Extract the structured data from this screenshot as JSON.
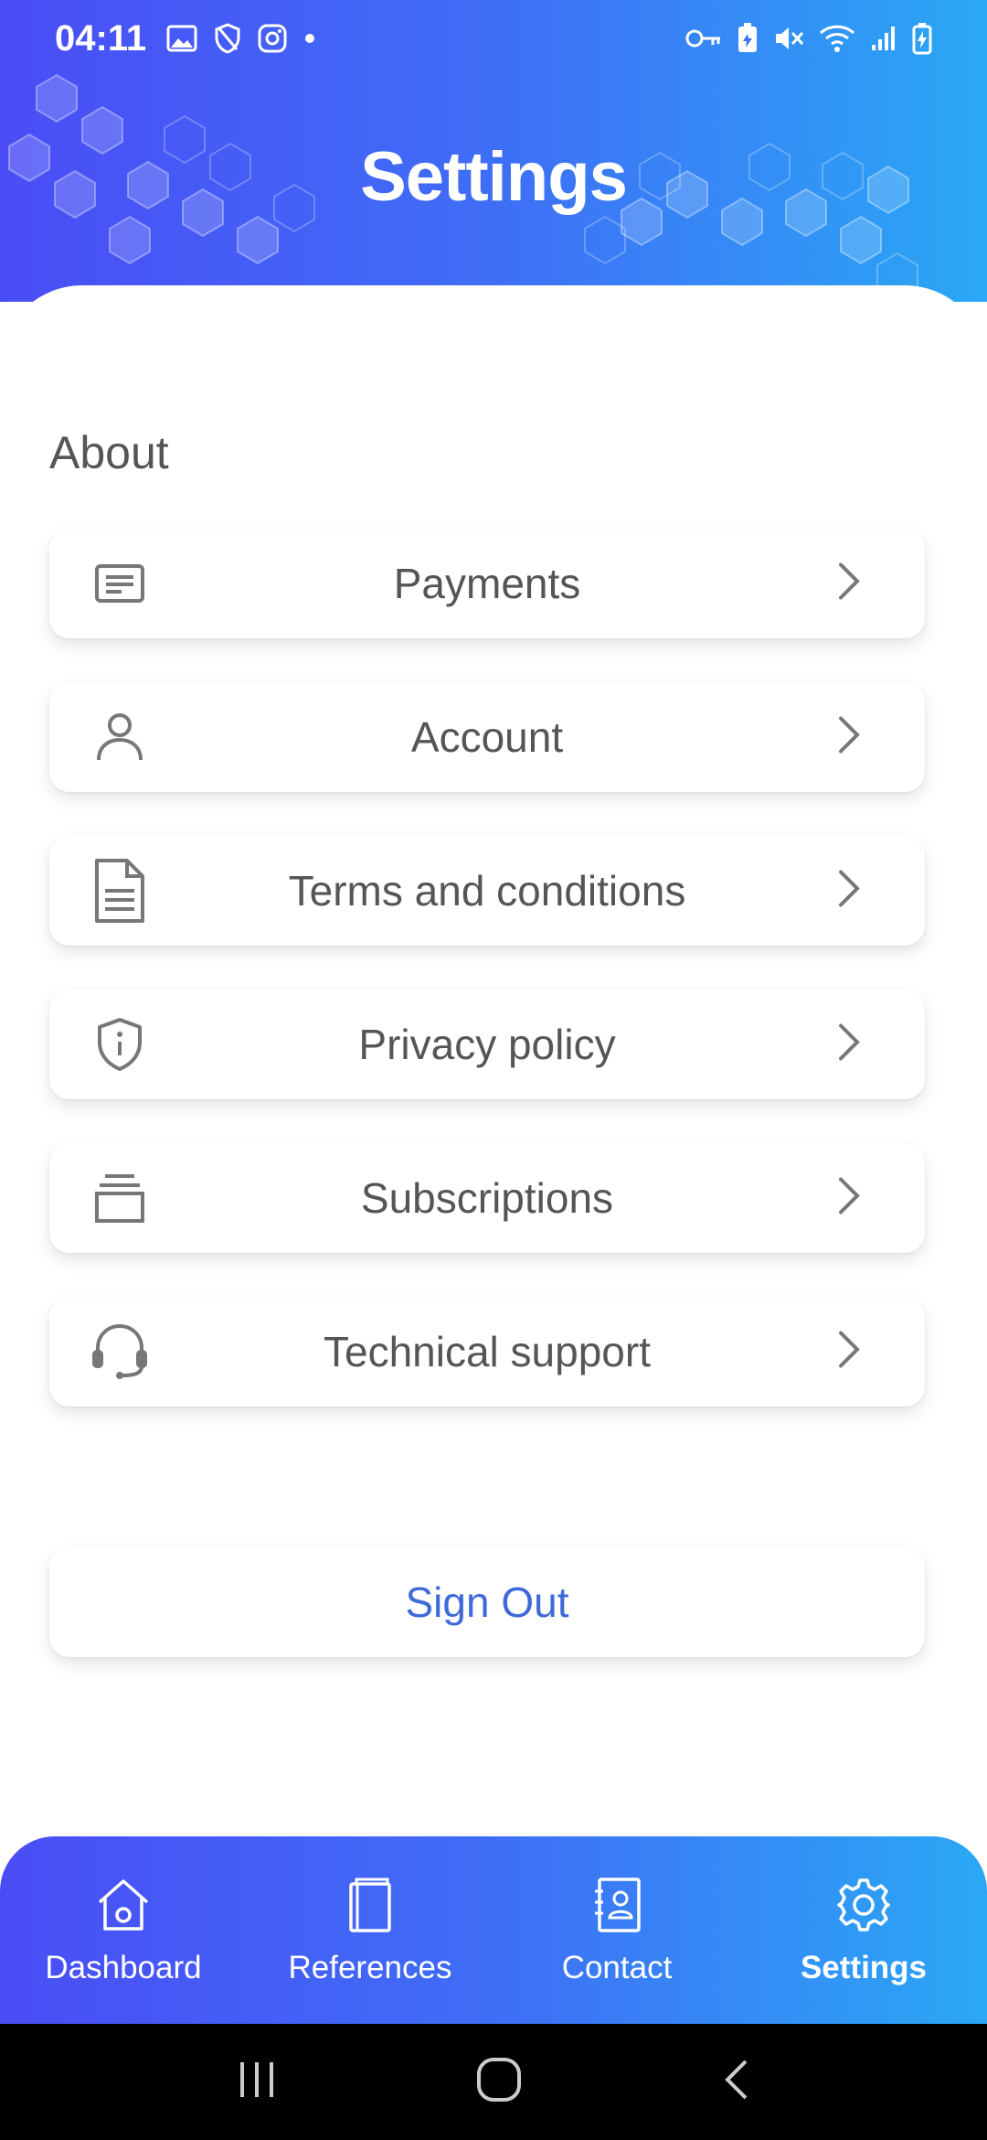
{
  "status_bar": {
    "time": "04:11",
    "left_icons": [
      "image-icon",
      "shield-icon",
      "instagram-icon",
      "dot-icon"
    ],
    "right_icons": [
      "key-icon",
      "battery-saver-icon",
      "mute-icon",
      "wifi-icon",
      "signal-icon",
      "battery-charging-icon"
    ]
  },
  "header": {
    "title": "Settings"
  },
  "section": {
    "title": "About"
  },
  "menu": [
    {
      "label": "Payments",
      "icon": "payments-icon"
    },
    {
      "label": "Account",
      "icon": "account-icon"
    },
    {
      "label": "Terms and conditions",
      "icon": "document-icon"
    },
    {
      "label": "Privacy policy",
      "icon": "privacy-shield-icon"
    },
    {
      "label": "Subscriptions",
      "icon": "subscriptions-icon"
    },
    {
      "label": "Technical support",
      "icon": "headset-icon"
    }
  ],
  "signout": {
    "label": "Sign Out"
  },
  "bottom_nav": [
    {
      "label": "Dashboard",
      "icon": "home-icon"
    },
    {
      "label": "References",
      "icon": "book-icon"
    },
    {
      "label": "Contact",
      "icon": "contact-book-icon"
    },
    {
      "label": "Settings",
      "icon": "gear-icon",
      "active": true
    }
  ],
  "colors": {
    "gradient_start": "#4a4df5",
    "gradient_end": "#2aa8f5",
    "signout": "#3e6ad9",
    "text": "#555555"
  }
}
